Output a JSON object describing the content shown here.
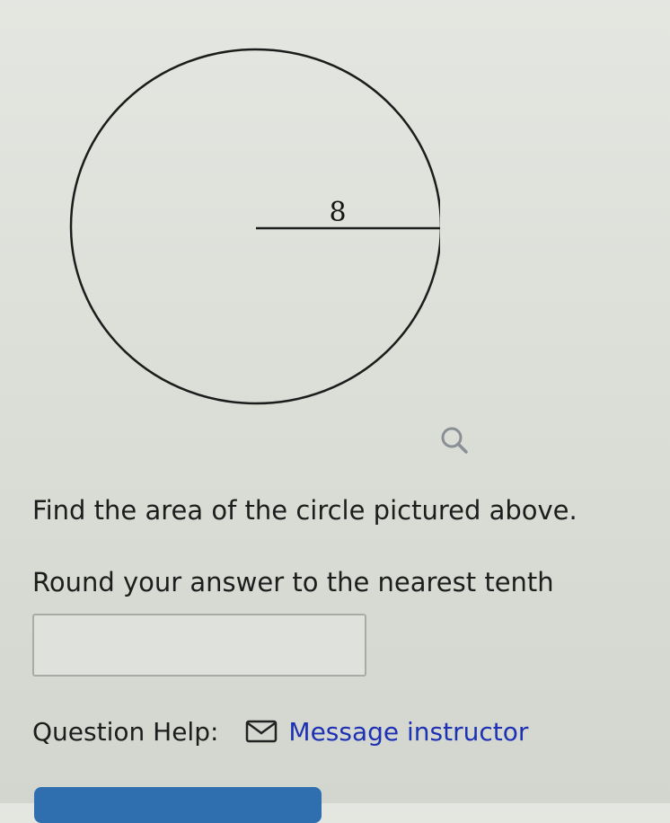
{
  "figure": {
    "radius_label": "8"
  },
  "question": {
    "line1": "Find the area of the circle pictured above.",
    "line2": "Round your answer to the nearest tenth"
  },
  "answer": {
    "value": "",
    "placeholder": ""
  },
  "help": {
    "label": "Question Help:",
    "message_link_label": "Message instructor",
    "link_color": "#1d31b4"
  },
  "icons": {
    "zoom": "magnifier-icon",
    "message": "envelope-icon"
  },
  "colors": {
    "background": "#dcdfd8",
    "text": "#1d1d1d",
    "submit_button": "#2f6fb0"
  }
}
